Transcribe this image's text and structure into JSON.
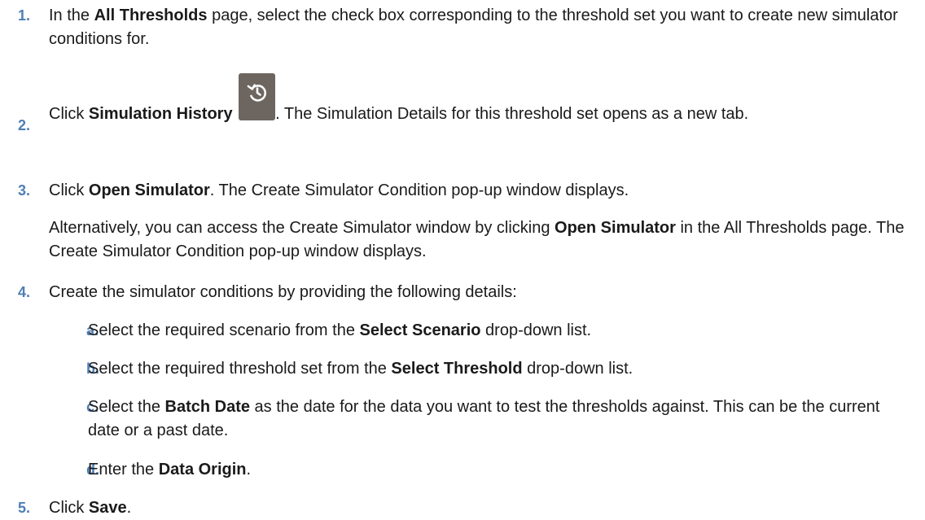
{
  "steps": [
    {
      "num": "1.",
      "parts": [
        "In the ",
        "All Thresholds",
        " page, select the check box corresponding to the threshold set you want to create new simulator conditions for."
      ]
    },
    {
      "num": "2.",
      "parts": [
        "Click ",
        "Simulation History",
        ". The Simulation Details for this threshold set opens as a new tab."
      ],
      "icon": "history-icon"
    },
    {
      "num": "3.",
      "parts": [
        "Click ",
        "Open Simulator",
        ". The Create Simulator Condition pop-up window displays."
      ],
      "note_parts": [
        "Alternatively, you can access the Create Simulator window by clicking ",
        "Open Simulator",
        " in the All Thresholds page. The Create Simulator Condition pop-up window displays."
      ]
    },
    {
      "num": "4.",
      "text": "Create the simulator conditions by providing the following details:",
      "substeps": [
        {
          "letter": "a.",
          "parts": [
            "Select the required scenario from the ",
            "Select Scenario",
            " drop-down list."
          ]
        },
        {
          "letter": "b.",
          "parts": [
            "Select the required threshold set from the ",
            "Select Threshold",
            " drop-down list."
          ]
        },
        {
          "letter": "c.",
          "parts": [
            "Select the ",
            "Batch Date",
            " as the date for the data you want to test the thresholds against. This can be the current date or a past date."
          ]
        },
        {
          "letter": "d.",
          "parts": [
            "Enter the ",
            "Data Origin",
            "."
          ]
        }
      ]
    },
    {
      "num": "5.",
      "parts": [
        "Click ",
        "Save",
        "."
      ]
    }
  ],
  "colors": {
    "step_number": "#4e7fb5",
    "icon_background": "#6d6660",
    "text": "#1a1a1a"
  }
}
